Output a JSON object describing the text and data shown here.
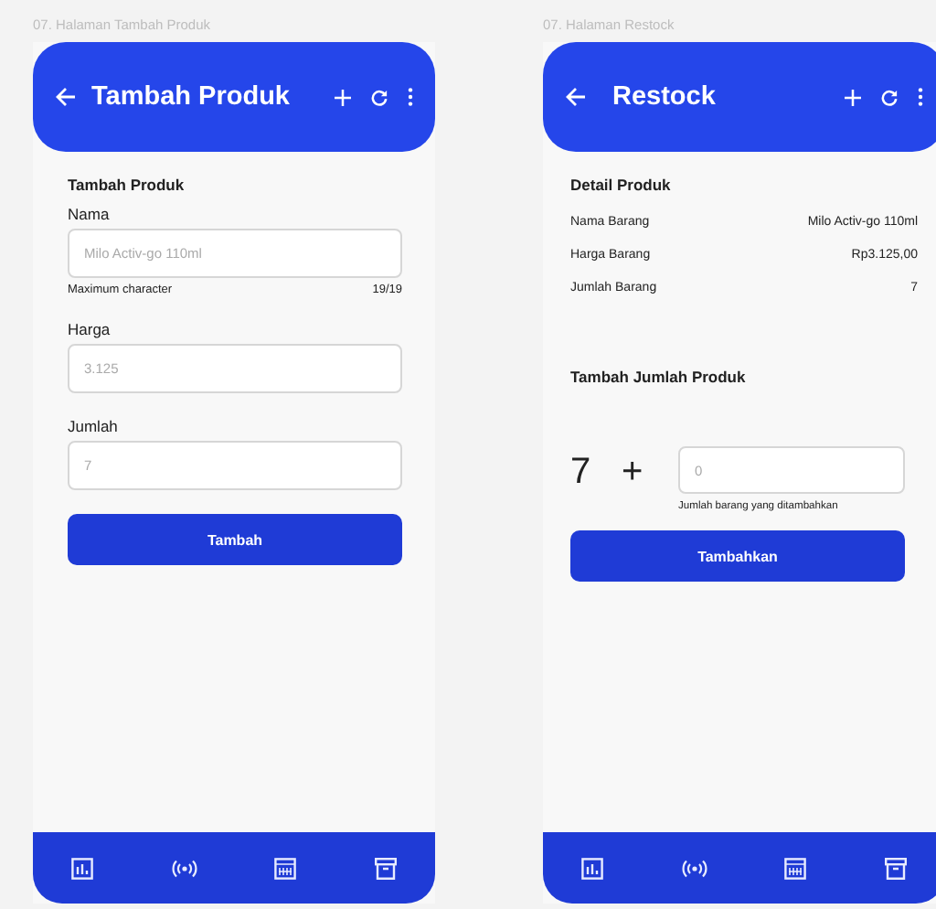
{
  "screens": [
    {
      "kind": "form",
      "caption": "07. Halaman Tambah Produk",
      "title": "Tambah Produk",
      "section": "Tambah Produk",
      "fields": [
        {
          "label": "Nama",
          "placeholder": "Milo Activ-go 110ml",
          "helper": "Maximum character",
          "counter": "19/19"
        },
        {
          "label": "Harga",
          "placeholder": "3.125"
        },
        {
          "label": "Jumlah",
          "placeholder": "7"
        }
      ],
      "button": "Tambah"
    },
    {
      "kind": "restock",
      "caption": "07. Halaman Restock",
      "title": "Restock",
      "section": "Detail Produk",
      "details": [
        {
          "label": "Nama Barang",
          "value": "Milo Activ-go 110ml"
        },
        {
          "label": "Harga Barang",
          "value": "Rp3.125,00"
        },
        {
          "label": "Jumlah Barang",
          "value": "7"
        }
      ],
      "add_section": "Tambah Jumlah Produk",
      "current": "7",
      "operator": "+",
      "input": {
        "placeholder": "0",
        "helper": "Jumlah barang yang ditambahkan"
      },
      "button": "Tambahkan"
    }
  ]
}
